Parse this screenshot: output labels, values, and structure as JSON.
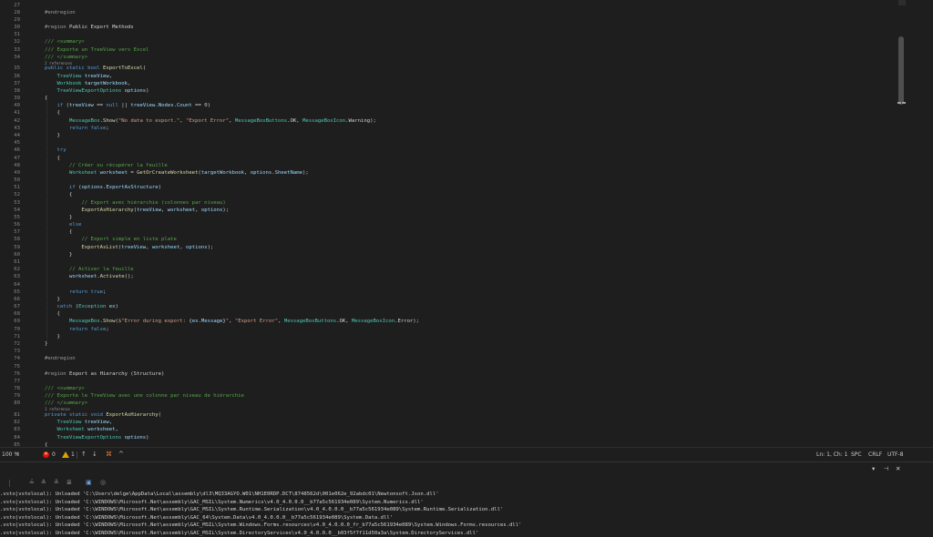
{
  "editor": {
    "line_numbers": [
      "27",
      "28",
      "29",
      "30",
      "31",
      "32",
      "33",
      "34",
      "35",
      "36",
      "37",
      "38",
      "39",
      "40",
      "41",
      "42",
      "43",
      "44",
      "45",
      "46",
      "47",
      "48",
      "49",
      "50",
      "51",
      "52",
      "53",
      "54",
      "55",
      "56",
      "57",
      "58",
      "59",
      "60",
      "61",
      "62",
      "63",
      "64",
      "65",
      "66",
      "67",
      "68",
      "69",
      "70",
      "71",
      "72",
      "73",
      "74",
      "75",
      "76",
      "77",
      "78",
      "79",
      "80",
      "81",
      "82",
      "83",
      "84",
      "85"
    ],
    "lines": [
      {
        "t": []
      },
      {
        "t": [
          [
            "rg",
            "#endregion"
          ]
        ]
      },
      {
        "t": []
      },
      {
        "t": [
          [
            "rg",
            "#region "
          ],
          [
            "pl",
            "Public Export Methods"
          ]
        ]
      },
      {
        "t": []
      },
      {
        "t": [
          [
            "cm",
            "/// <summary>"
          ]
        ]
      },
      {
        "t": [
          [
            "cm",
            "/// Exporte un TreeView vers Excel"
          ]
        ]
      },
      {
        "t": [
          [
            "cm",
            "/// </summary>"
          ]
        ],
        "ref": "2 references"
      },
      {
        "t": [
          [
            "kw",
            "public static bool "
          ],
          [
            "mt",
            "ExportToExcel"
          ],
          [
            "pl",
            "("
          ]
        ]
      },
      {
        "t": [
          [
            "pl",
            "    "
          ],
          [
            "ct",
            "TreeView"
          ],
          [
            "pr",
            " treeView"
          ],
          [
            "pl",
            ","
          ]
        ]
      },
      {
        "t": [
          [
            "pl",
            "    "
          ],
          [
            "ct",
            "Workbook"
          ],
          [
            "pr",
            " targetWorkbook"
          ],
          [
            "pl",
            ","
          ]
        ]
      },
      {
        "t": [
          [
            "pl",
            "    "
          ],
          [
            "ct",
            "TreeViewExportOptions"
          ],
          [
            "pr",
            " options"
          ],
          [
            "pl",
            ")"
          ]
        ]
      },
      {
        "t": [
          [
            "pl",
            "{"
          ]
        ]
      },
      {
        "t": [
          [
            "pl",
            "    "
          ],
          [
            "kw",
            "if"
          ],
          [
            "pl",
            " ("
          ],
          [
            "pr",
            "treeView"
          ],
          [
            "pl",
            " == "
          ],
          [
            "kw",
            "null"
          ],
          [
            "pl",
            " || "
          ],
          [
            "pr",
            "treeView"
          ],
          [
            "pl",
            "."
          ],
          [
            "pr",
            "Nodes"
          ],
          [
            "pl",
            "."
          ],
          [
            "pr",
            "Count"
          ],
          [
            "pl",
            " == "
          ],
          [
            "nm",
            "0"
          ],
          [
            "pl",
            ")"
          ]
        ]
      },
      {
        "t": [
          [
            "pl",
            "    {"
          ]
        ]
      },
      {
        "t": [
          [
            "pl",
            "        "
          ],
          [
            "ct",
            "MessageBox"
          ],
          [
            "pl",
            "."
          ],
          [
            "mt",
            "Show"
          ],
          [
            "pl",
            "("
          ],
          [
            "st",
            "\"No data to export.\""
          ],
          [
            "pl",
            ", "
          ],
          [
            "st",
            "\"Export Error\""
          ],
          [
            "pl",
            ", "
          ],
          [
            "ct",
            "MessageBoxButtons"
          ],
          [
            "pl",
            ".OK, "
          ],
          [
            "ct",
            "MessageBoxIcon"
          ],
          [
            "pl",
            ".Warning);"
          ]
        ]
      },
      {
        "t": [
          [
            "pl",
            "        "
          ],
          [
            "kw",
            "return false"
          ],
          [
            "pl",
            ";"
          ]
        ]
      },
      {
        "t": [
          [
            "pl",
            "    }"
          ]
        ]
      },
      {
        "t": []
      },
      {
        "t": [
          [
            "pl",
            "    "
          ],
          [
            "kw",
            "try"
          ]
        ]
      },
      {
        "t": [
          [
            "pl",
            "    {"
          ]
        ]
      },
      {
        "t": [
          [
            "pl",
            "        "
          ],
          [
            "cm",
            "// Créer ou récupérer la feuille"
          ]
        ]
      },
      {
        "t": [
          [
            "pl",
            "        "
          ],
          [
            "ct",
            "Worksheet"
          ],
          [
            "pr",
            " worksheet"
          ],
          [
            "pl",
            " = "
          ],
          [
            "mt",
            "GetOrCreateWorksheet"
          ],
          [
            "pl",
            "("
          ],
          [
            "pr",
            "targetWorkbook"
          ],
          [
            "pl",
            ", "
          ],
          [
            "pr",
            "options"
          ],
          [
            "pl",
            "."
          ],
          [
            "pr",
            "SheetName"
          ],
          [
            "pl",
            ");"
          ]
        ]
      },
      {
        "t": []
      },
      {
        "t": [
          [
            "pl",
            "        "
          ],
          [
            "kw",
            "if"
          ],
          [
            "pl",
            " ("
          ],
          [
            "pr",
            "options"
          ],
          [
            "pl",
            "."
          ],
          [
            "pr",
            "ExportAsStructure"
          ],
          [
            "pl",
            ")"
          ]
        ]
      },
      {
        "t": [
          [
            "pl",
            "        {"
          ]
        ]
      },
      {
        "t": [
          [
            "pl",
            "            "
          ],
          [
            "cm",
            "// Export avec hiérarchie (colonnes par niveau)"
          ]
        ]
      },
      {
        "t": [
          [
            "pl",
            "            "
          ],
          [
            "mt",
            "ExportAsHierarchy"
          ],
          [
            "pl",
            "("
          ],
          [
            "pr",
            "treeView"
          ],
          [
            "pl",
            ", "
          ],
          [
            "pr",
            "worksheet"
          ],
          [
            "pl",
            ", "
          ],
          [
            "pr",
            "options"
          ],
          [
            "pl",
            ");"
          ]
        ]
      },
      {
        "t": [
          [
            "pl",
            "        }"
          ]
        ]
      },
      {
        "t": [
          [
            "pl",
            "        "
          ],
          [
            "kw",
            "else"
          ]
        ]
      },
      {
        "t": [
          [
            "pl",
            "        {"
          ]
        ]
      },
      {
        "t": [
          [
            "pl",
            "            "
          ],
          [
            "cm",
            "// Export simple en liste plate"
          ]
        ]
      },
      {
        "t": [
          [
            "pl",
            "            "
          ],
          [
            "mt",
            "ExportAsList"
          ],
          [
            "pl",
            "("
          ],
          [
            "pr",
            "treeView"
          ],
          [
            "pl",
            ", "
          ],
          [
            "pr",
            "worksheet"
          ],
          [
            "pl",
            ", "
          ],
          [
            "pr",
            "options"
          ],
          [
            "pl",
            ");"
          ]
        ]
      },
      {
        "t": [
          [
            "pl",
            "        }"
          ]
        ]
      },
      {
        "t": []
      },
      {
        "t": [
          [
            "pl",
            "        "
          ],
          [
            "cm",
            "// Activer la feuille"
          ]
        ]
      },
      {
        "t": [
          [
            "pl",
            "        "
          ],
          [
            "pr",
            "worksheet"
          ],
          [
            "pl",
            "."
          ],
          [
            "mt",
            "Activate"
          ],
          [
            "pl",
            "();"
          ]
        ]
      },
      {
        "t": []
      },
      {
        "t": [
          [
            "pl",
            "        "
          ],
          [
            "kw",
            "return true"
          ],
          [
            "pl",
            ";"
          ]
        ]
      },
      {
        "t": [
          [
            "pl",
            "    }"
          ]
        ]
      },
      {
        "t": [
          [
            "pl",
            "    "
          ],
          [
            "kw",
            "catch"
          ],
          [
            "pl",
            " ("
          ],
          [
            "ct",
            "Exception"
          ],
          [
            "pr",
            " ex"
          ],
          [
            "pl",
            ")"
          ]
        ]
      },
      {
        "t": [
          [
            "pl",
            "    {"
          ]
        ]
      },
      {
        "t": [
          [
            "pl",
            "        "
          ],
          [
            "ct",
            "MessageBox"
          ],
          [
            "pl",
            "."
          ],
          [
            "mt",
            "Show"
          ],
          [
            "pl",
            "("
          ],
          [
            "st",
            "$\"Error during export: "
          ],
          [
            "pl",
            "{"
          ],
          [
            "pr",
            "ex"
          ],
          [
            "pl",
            "."
          ],
          [
            "pr",
            "Message"
          ],
          [
            "pl",
            "}"
          ],
          [
            "st",
            "\""
          ],
          [
            "pl",
            ", "
          ],
          [
            "st",
            "\"Export Error\""
          ],
          [
            "pl",
            ", "
          ],
          [
            "ct",
            "MessageBoxButtons"
          ],
          [
            "pl",
            ".OK, "
          ],
          [
            "ct",
            "MessageBoxIcon"
          ],
          [
            "pl",
            ".Error);"
          ]
        ]
      },
      {
        "t": [
          [
            "pl",
            "        "
          ],
          [
            "kw",
            "return false"
          ],
          [
            "pl",
            ";"
          ]
        ]
      },
      {
        "t": [
          [
            "pl",
            "    }"
          ]
        ]
      },
      {
        "t": [
          [
            "pl",
            "}"
          ]
        ]
      },
      {
        "t": []
      },
      {
        "t": [
          [
            "rg",
            "#endregion"
          ]
        ]
      },
      {
        "t": []
      },
      {
        "t": [
          [
            "rg",
            "#region "
          ],
          [
            "pl",
            "Export as Hierarchy (Structure)"
          ]
        ]
      },
      {
        "t": []
      },
      {
        "t": [
          [
            "cm",
            "/// <summary>"
          ]
        ]
      },
      {
        "t": [
          [
            "cm",
            "/// Exporte le TreeView avec une colonne par niveau de hiérarchie"
          ]
        ]
      },
      {
        "t": [
          [
            "cm",
            "/// </summary>"
          ]
        ],
        "ref": "1 reference"
      },
      {
        "t": [
          [
            "kw",
            "private static void "
          ],
          [
            "mt",
            "ExportAsHierarchy"
          ],
          [
            "pl",
            "("
          ]
        ]
      },
      {
        "t": [
          [
            "pl",
            "    "
          ],
          [
            "ct",
            "TreeView"
          ],
          [
            "pr",
            " treeView"
          ],
          [
            "pl",
            ","
          ]
        ]
      },
      {
        "t": [
          [
            "pl",
            "    "
          ],
          [
            "ct",
            "Worksheet"
          ],
          [
            "pr",
            " worksheet"
          ],
          [
            "pl",
            ","
          ]
        ]
      },
      {
        "t": [
          [
            "pl",
            "    "
          ],
          [
            "ct",
            "TreeViewExportOptions"
          ],
          [
            "pr",
            " options"
          ],
          [
            "pl",
            ")"
          ]
        ]
      },
      {
        "t": [
          [
            "pl",
            "{"
          ]
        ]
      }
    ]
  },
  "status_bar": {
    "zoom": "100 %",
    "errors": "0",
    "warnings": "1",
    "position": "Ln: 1, Ch: 1",
    "whitespace": "SPC",
    "line_ending": "CRLF",
    "encoding": "UTF-8"
  },
  "output": {
    "lines": [
      ".vsto|vstolocal): Unloaded 'C:\\Users\\delge\\AppData\\Local\\assembly\\dl3\\MQ33AGYO.W01\\NH1E0RDP.DCT\\8748562d\\001e062e_92abdc01\\Newtonsoft.Json.dll'",
      ".vsto|vstolocal): Unloaded 'C:\\WINDOWS\\Microsoft.Net\\assembly\\GAC_MSIL\\System.Numerics\\v4.0_4.0.0.0__b77a5c561934e089\\System.Numerics.dll'",
      ".vsto|vstolocal): Unloaded 'C:\\WINDOWS\\Microsoft.Net\\assembly\\GAC_MSIL\\System.Runtime.Serialization\\v4.0_4.0.0.0__b77a5c561934e089\\System.Runtime.Serialization.dll'",
      ".vsto|vstolocal): Unloaded 'C:\\WINDOWS\\Microsoft.Net\\assembly\\GAC_64\\System.Data\\v4.0_4.0.0.0__b77a5c561934e089\\System.Data.dll'",
      ".vsto|vstolocal): Unloaded 'C:\\WINDOWS\\Microsoft.Net\\assembly\\GAC_MSIL\\System.Windows.Forms.resources\\v4.0_4.0.0.0_fr_b77a5c561934e089\\System.Windows.Forms.resources.dll'",
      ".vsto|vstolocal): Unloaded 'C:\\WINDOWS\\Microsoft.Net\\assembly\\GAC_MSIL\\System.DirectoryServices\\v4.0_4.0.0.0__b03f5f7f11d50a3a\\System.DirectoryServices.dll'"
    ]
  },
  "icons": {
    "error": "error-icon",
    "warning": "warning-icon",
    "arrow_up": "arrow-up-icon",
    "arrow_down": "arrow-down-icon",
    "brush": "brush-icon",
    "chevron_up": "chevron-up-icon",
    "pin": "pin-icon",
    "close": "close-icon",
    "dropdown": "dropdown-icon"
  },
  "colors": {
    "background": "#1e1e1e",
    "keyword": "#569cd6",
    "type": "#4ec9b0",
    "comment": "#57a64a",
    "string": "#d69d85",
    "method": "#dcdcaa",
    "identifier": "#9cdcfe",
    "error_badge": "#e51400",
    "warning_badge": "#d9a400"
  }
}
